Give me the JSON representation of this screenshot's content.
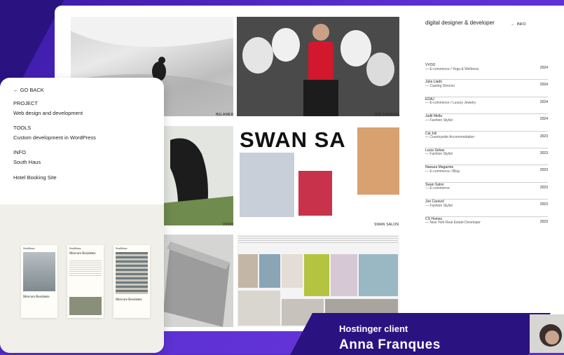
{
  "header": {
    "title": "digital designer & developer",
    "info_label": "INFO"
  },
  "tiles": [
    {
      "label": "BELAMER"
    },
    {
      "label": "JOE CARAVOL"
    },
    {
      "label": "VVOO"
    },
    {
      "label": "SWAN SALON"
    },
    {
      "label": ""
    },
    {
      "label": ""
    }
  ],
  "swan_text": "SWAN SA",
  "projects": [
    {
      "name": "VVOO",
      "category": "— E-commerce / Yoga & Wellness",
      "year": "2024"
    },
    {
      "name": "Julia Lladó",
      "category": "— Casting Director",
      "year": "2024"
    },
    {
      "name": "EDAJ",
      "category": "— E-commerce / Luxury Jewelry",
      "year": "2024"
    },
    {
      "name": "Judit Mella",
      "category": "— Fashion Stylist",
      "year": "2024"
    },
    {
      "name": "Cal Joli",
      "category": "— Countryside Accommodation",
      "year": "2023"
    },
    {
      "name": "Lucia Sebas",
      "category": "— Fashion Stylist",
      "year": "2023"
    },
    {
      "name": "Nawara Magazine",
      "category": "— E-commerce / Blog",
      "year": "2023"
    },
    {
      "name": "Swan Salon",
      "category": "— E-commerce",
      "year": "2023"
    },
    {
      "name": "Joe Caravol",
      "category": "— Fashion Stylist",
      "year": "2023"
    },
    {
      "name": "CS Homes",
      "category": "— New York Real Estate Developer",
      "year": "2023"
    }
  ],
  "side": {
    "back_label": "← GO BACK",
    "project_heading": "PROJECT",
    "project_value": "Web design and development",
    "tools_heading": "TOOLS",
    "tools_value": "Custom development in WordPress",
    "info_heading": "INFO",
    "info_value": "South Haus",
    "extra_value": "Hotel Booking Site",
    "preview_brand": "Southhaus",
    "preview_title": "Mercure Residents"
  },
  "banner": {
    "line1": "Hostinger client",
    "line2": "Anna Franques"
  },
  "colors": {
    "purple": "#5b2fd0",
    "dark_purple": "#2a1380"
  }
}
